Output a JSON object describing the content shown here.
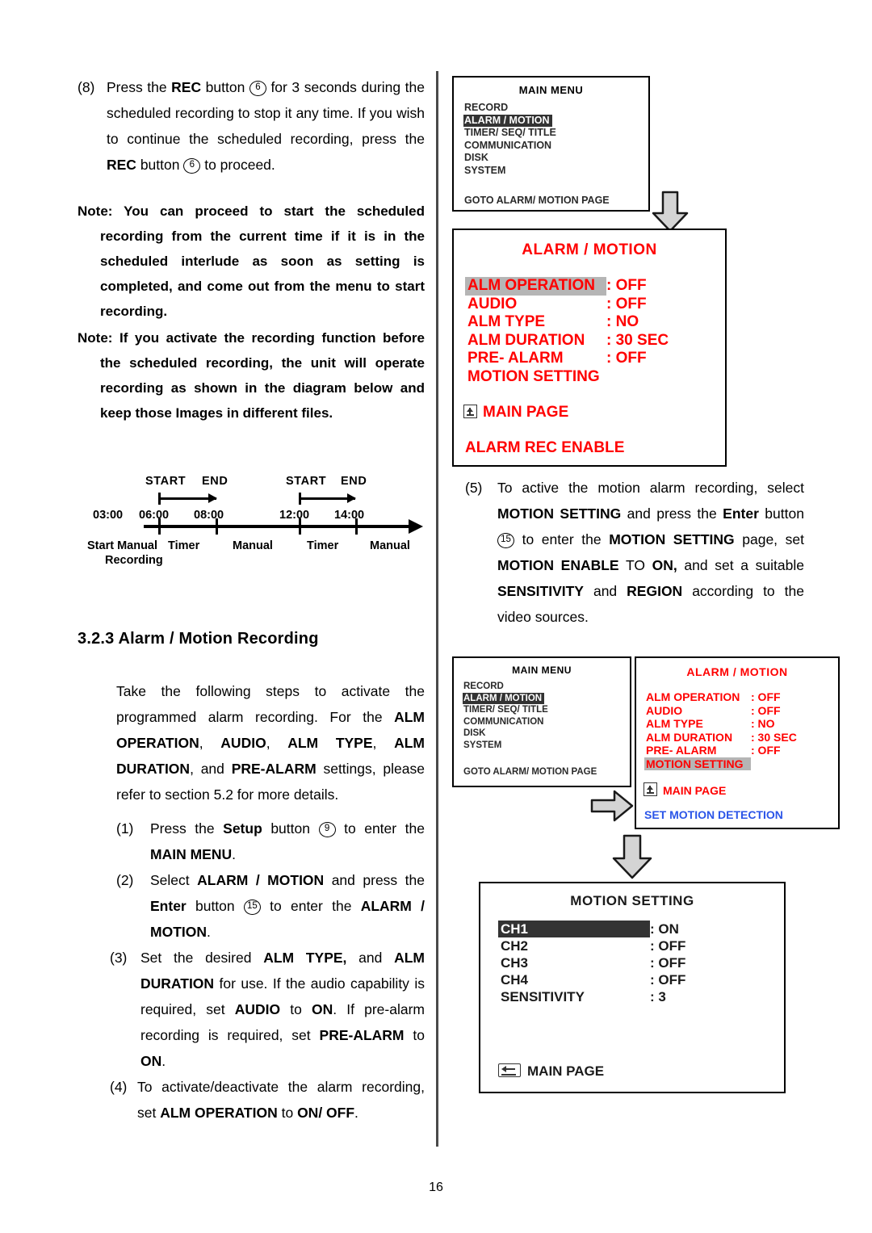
{
  "document": {
    "page_number": "16",
    "section_heading": "3.2.3 Alarm / Motion Recording"
  },
  "left_column": {
    "step8": {
      "marker": "(8)",
      "text_pre": "Press the ",
      "bold1": "REC",
      "text_mid1": " button ",
      "badge1": "6",
      "text_mid2": " for 3 seconds during the scheduled recording to stop it any time. If you wish to continue the scheduled recording, press the ",
      "bold2": "REC",
      "text_mid3": " button ",
      "badge2": "6",
      "text_end": " to proceed."
    },
    "note1": "Note: You can proceed to start the scheduled recording from the current time if it is in the scheduled interlude as soon as setting is completed, and come out from the menu to start recording.",
    "note2": "Note: If you activate the recording function before the scheduled recording, the unit will operate recording as shown in the diagram below and keep those Images in different files.",
    "intro": {
      "t1": "Take the following steps to activate the programmed alarm recording. For the ",
      "b1": "ALM OPERATION",
      "t2": ", ",
      "b2": "AUDIO",
      "t3": ", ",
      "b3": "ALM TYPE",
      "t4": ", ",
      "b4": "ALM DURATION",
      "t5": ", and ",
      "b5": "PRE-ALARM",
      "t6": " settings, please refer to section 5.2 for more details."
    },
    "step1": {
      "marker": "(1)",
      "t1": "Press the ",
      "b1": "Setup",
      "t2": " button ",
      "badge": "9",
      "t3": " to enter the ",
      "b2": "MAIN MENU",
      "t4": "."
    },
    "step2": {
      "marker": "(2)",
      "t1": "Select ",
      "b1": "ALARM / MOTION",
      "t2": " and press the ",
      "b2": "Enter",
      "t3": " button ",
      "badge": "15",
      "t4": " to enter the ",
      "b3": "ALARM / MOTION",
      "t5": "."
    },
    "step3": {
      "marker": "(3)",
      "t1": "Set the desired ",
      "b1": "ALM TYPE,",
      "t2": " and ",
      "b2": "ALM DURATION",
      "t3": " for use. If the audio capability is required, set ",
      "b3": "AUDIO",
      "t4": " to ",
      "b4": "ON",
      "t5": ". If pre-alarm recording is required, set ",
      "b5": "PRE-ALARM",
      "t6": " to ",
      "b6": "ON",
      "t7": "."
    },
    "step4": {
      "marker": "(4)",
      "t1": "To activate/deactivate the alarm recording, set ",
      "b1": "ALM OPERATION",
      "t2": " to ",
      "b2": "ON/ OFF",
      "t3": "."
    }
  },
  "timeline": {
    "markers": [
      {
        "label": "START",
        "time": "06:00"
      },
      {
        "label": "END",
        "time": "08:00"
      },
      {
        "label": "START",
        "time": "12:00"
      },
      {
        "label": "END",
        "time": "14:00"
      }
    ],
    "start_time": "03:00",
    "times": [
      "03:00",
      "06:00",
      "08:00",
      "12:00",
      "14:00"
    ],
    "start_label_line1": "Start Manual",
    "start_label_line2": "Recording",
    "segments": [
      "Timer",
      "Manual",
      "Timer",
      "Manual"
    ],
    "span_labels": [
      "START",
      "END",
      "START",
      "END"
    ]
  },
  "right_column": {
    "step5": {
      "marker": "(5)",
      "t1": "To active the motion alarm recording, select ",
      "b1": "MOTION SETTING",
      "t2": " and press the ",
      "b2": "Enter",
      "t3": " button ",
      "badge": "15",
      "t4": " to enter the ",
      "b3": "MOTION SETTING",
      "t5": " page, set ",
      "b4": "MOTION ENABLE",
      "t6": " TO ",
      "b5": "ON,",
      "t7": " and set a suitable ",
      "b6": "SENSITIVITY",
      "t8": " and ",
      "b7": "REGION",
      "t9": " according to the video sources."
    }
  },
  "main_menu": {
    "title": "MAIN  MENU",
    "items": [
      {
        "label": "RECORD",
        "highlighted": false
      },
      {
        "label": "ALARM / MOTION",
        "highlighted": true
      },
      {
        "label": "TIMER/ SEQ/ TITLE",
        "highlighted": false
      },
      {
        "label": "COMMUNICATION",
        "highlighted": false
      },
      {
        "label": "DISK",
        "highlighted": false
      },
      {
        "label": "SYSTEM",
        "highlighted": false
      }
    ],
    "footer": "GOTO ALARM/ MOTION PAGE"
  },
  "alarm_motion_panel_1": {
    "title": "ALARM / MOTION",
    "rows": [
      {
        "key": "ALM OPERATION",
        "value": ": OFF",
        "highlighted": true
      },
      {
        "key": "AUDIO",
        "value": ": OFF",
        "highlighted": false
      },
      {
        "key": "ALM TYPE",
        "value": ": NO",
        "highlighted": false
      },
      {
        "key": "ALM DURATION",
        "value": ": 30   SEC",
        "highlighted": false
      },
      {
        "key": "PRE- ALARM",
        "value": ": OFF",
        "highlighted": false
      },
      {
        "key": "MOTION SETTING",
        "value": "",
        "highlighted": false
      }
    ],
    "main_page": "MAIN PAGE",
    "footer": "ALARM REC ENABLE"
  },
  "alarm_motion_panel_2": {
    "title": "ALARM / MOTION",
    "rows": [
      {
        "key": "ALM OPERATION",
        "value": ": OFF",
        "highlighted": false
      },
      {
        "key": "AUDIO",
        "value": ": OFF",
        "highlighted": false
      },
      {
        "key": "ALM TYPE",
        "value": ": NO",
        "highlighted": false
      },
      {
        "key": "ALM DURATION",
        "value": ": 30   SEC",
        "highlighted": false
      },
      {
        "key": "PRE- ALARM",
        "value": ": OFF",
        "highlighted": false
      },
      {
        "key": "MOTION SETTING",
        "value": "",
        "highlighted": true
      }
    ],
    "main_page": "MAIN PAGE",
    "footer": "SET MOTION DETECTION"
  },
  "motion_setting_panel": {
    "title": "MOTION SETTING",
    "rows": [
      {
        "key": "CH1",
        "value": ": ON",
        "highlighted": true
      },
      {
        "key": "CH2",
        "value": ": OFF",
        "highlighted": false
      },
      {
        "key": "CH3",
        "value": ": OFF",
        "highlighted": false
      },
      {
        "key": "CH4",
        "value": ": OFF",
        "highlighted": false
      },
      {
        "key": "SENSITIVITY",
        "value": ": 3",
        "highlighted": false
      }
    ],
    "main_page": "MAIN PAGE"
  },
  "colors": {
    "osd_red": "#ff0000",
    "osd_blue": "#2b55e8",
    "highlight_dark": "#333333",
    "highlight_gray": "#b5b5b5"
  }
}
